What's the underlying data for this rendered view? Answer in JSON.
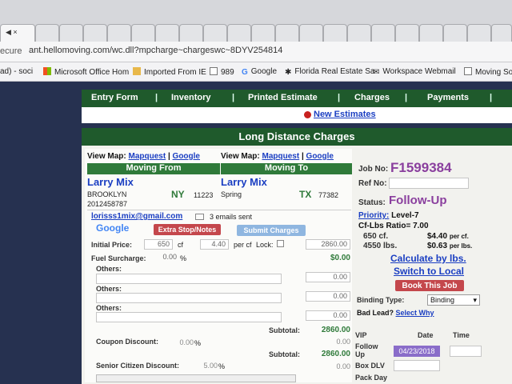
{
  "browser": {
    "tabs": [
      {
        "label": "◀ ×",
        "active": true
      },
      {
        "label": "",
        "active": false
      }
    ],
    "address": {
      "prefix": "ecure",
      "url": "ant.hellomoving.com/wc.dll?mpcharge~chargeswc~8DYV254814"
    },
    "bookmarks": [
      {
        "label": "ad) - soci",
        "icon": "page-icon"
      },
      {
        "label": "Microsoft Office Hom",
        "icon": "office-icon"
      },
      {
        "label": "Imported From IE",
        "icon": "folder-icon"
      },
      {
        "label": "989",
        "icon": "page-icon"
      },
      {
        "label": "Google",
        "icon": "google-icon"
      },
      {
        "label": "Florida Real Estate Sa",
        "icon": "star-icon"
      },
      {
        "label": "Workspace Webmail",
        "icon": "mail-icon"
      },
      {
        "label": "Moving Sof",
        "icon": "page-icon"
      }
    ]
  },
  "nav": {
    "items": [
      "Entry Form",
      "Inventory",
      "Printed Estimate",
      "Charges",
      "Payments"
    ],
    "separator": "|",
    "new_estimates": "New Estimates"
  },
  "title": "Long Distance Charges",
  "moving_from": {
    "view_map_label": "View Map:",
    "mapquest": "Mapquest",
    "sep": "|",
    "google": "Google",
    "header": "Moving From",
    "name": "Larry Mix",
    "city": "BROOKLYN",
    "state": "NY",
    "zip": "11223",
    "phone": "2012458787"
  },
  "moving_to": {
    "view_map_label": "View Map:",
    "mapquest": "Mapquest",
    "sep": "|",
    "google": "Google",
    "header": "Moving To",
    "name": "Larry Mix",
    "city": "Spring",
    "state": "TX",
    "zip": "77382"
  },
  "email": {
    "address": "lorisss1mix@gmail.com",
    "sent": "3 emails sent"
  },
  "actions": {
    "google_logo": "Google",
    "extra_stop": "Extra Stop/Notes",
    "submit_charges": "Submit Charges"
  },
  "charges": {
    "initial_price_label": "Initial Price:",
    "initial_price_value": "650",
    "cf_label": "cf",
    "rate_value": "4.40",
    "per_cf_label": "per cf",
    "lock_label": "Lock:",
    "initial_total": "2860.00",
    "fuel_label": "Fuel Surcharge:",
    "fuel_value": "0.00",
    "fuel_pct": "%",
    "fuel_total": "$0.00",
    "others1_label": "Others:",
    "others1_total": "0.00",
    "others2_label": "Others:",
    "others2_total": "0.00",
    "others3_label": "Others:",
    "others3_total": "0.00",
    "subtotal1_label": "Subtotal:",
    "subtotal1_value": "2860.00",
    "coupon_label": "Coupon Discount:",
    "coupon_value": "0.00",
    "coupon_pct": "%",
    "coupon_total": "0.00",
    "subtotal2_label": "Subtotal:",
    "subtotal2_value": "2860.00",
    "senior_label": "Senior Citizen Discount:",
    "senior_value": "5.00",
    "senior_pct": "%",
    "senior_total": "0.00"
  },
  "job": {
    "job_no_label": "Job No:",
    "job_no": "F1599384",
    "ref_no_label": "Ref No:",
    "status_label": "Status:",
    "status": "Follow-Up",
    "priority_label": "Priority:",
    "priority": "Level-7",
    "ratio_label": "Cf-Lbs Ratio=",
    "ratio": "7.00",
    "cf_line": "650 cf.",
    "cf_rate": "$4.40",
    "cf_rate_unit": "per cf.",
    "lbs_line": "4550 lbs.",
    "lbs_rate": "$0.63",
    "lbs_rate_unit": "per lbs.",
    "calc_lbs": "Calculate by lbs.",
    "switch_local": "Switch to Local",
    "book_job": "Book This Job",
    "binding_label": "Binding Type:",
    "binding_value": "Binding",
    "bad_lead_label": "Bad Lead?",
    "select_why": "Select Why",
    "vip_label": "VIP",
    "date_label": "Date",
    "time_label": "Time",
    "follow_label": "Follow Up",
    "follow_date": "04/23/2018",
    "box_label": "Box DLV",
    "pack_label": "Pack Day"
  },
  "colors": {
    "nav_green": "#1f5a2c",
    "header_green": "#2f7a3a",
    "link_blue": "#1a3ec2",
    "purple": "#8a3f9e",
    "red_button": "#c4474c"
  }
}
